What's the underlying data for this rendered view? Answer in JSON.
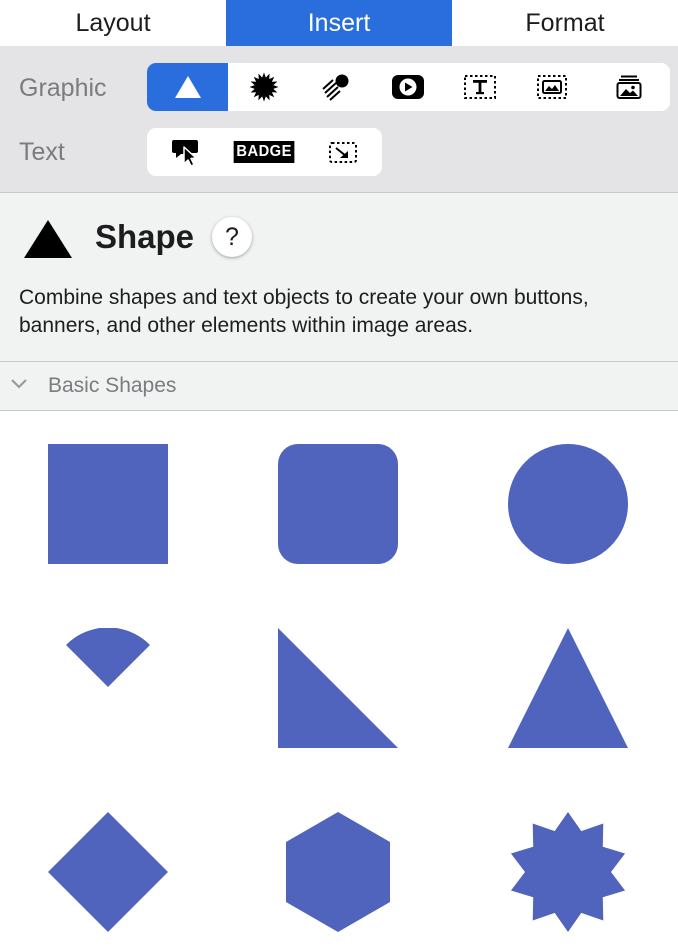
{
  "tabs": [
    {
      "label": "Layout",
      "active": false
    },
    {
      "label": "Insert",
      "active": true
    },
    {
      "label": "Format",
      "active": false
    }
  ],
  "graphic_row": {
    "label": "Graphic",
    "items": [
      {
        "icon": "triangle-shape-icon",
        "selected": true
      },
      {
        "icon": "starburst-icon",
        "selected": false
      },
      {
        "icon": "comet-icon",
        "selected": false
      },
      {
        "icon": "play-video-icon",
        "selected": false
      },
      {
        "icon": "text-frame-icon",
        "selected": false
      },
      {
        "icon": "image-frame-icon",
        "selected": false
      },
      {
        "icon": "image-stack-icon",
        "selected": false
      }
    ]
  },
  "text_row": {
    "label": "Text",
    "items": [
      {
        "icon": "callout-pointer-icon"
      },
      {
        "icon": "badge-icon",
        "text": "BADGE"
      },
      {
        "icon": "resize-frame-icon"
      }
    ]
  },
  "info": {
    "title": "Shape",
    "help": "?",
    "description": "Combine shapes and text objects to create your own buttons, banners, and other elements within image areas."
  },
  "section": {
    "label": "Basic Shapes",
    "expanded": true
  },
  "shapes": [
    "square",
    "rounded-square",
    "circle",
    "wedge",
    "right-triangle",
    "triangle",
    "diamond",
    "hexagon",
    "star"
  ],
  "colors": {
    "accent": "#2a6ede",
    "shape_fill": "#5063bd"
  }
}
